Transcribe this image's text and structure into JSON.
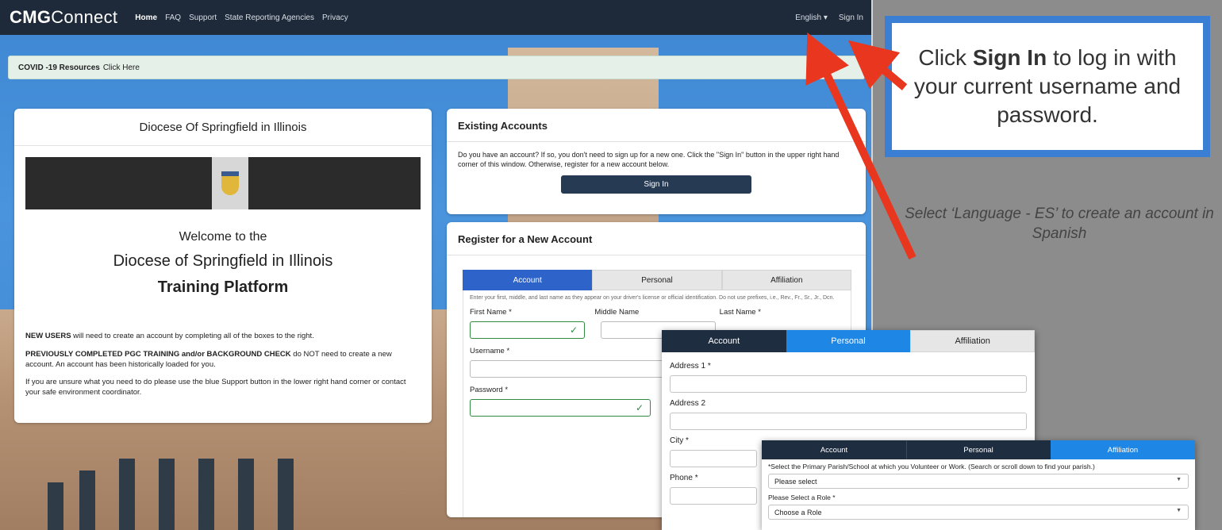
{
  "nav": {
    "brand_bold": "CMG",
    "brand_light": "Connect",
    "links": [
      "Home",
      "FAQ",
      "Support",
      "State Reporting Agencies",
      "Privacy"
    ],
    "language": "English",
    "signin": "Sign In"
  },
  "covid": {
    "bold": "COVID -19 Resources",
    "link": "Click Here"
  },
  "left": {
    "title": "Diocese Of Springfield in Illinois",
    "welcome1": "Welcome to the",
    "welcome2": "Diocese of Springfield in Illinois",
    "welcome3": "Training Platform",
    "p1_bold": "NEW USERS",
    "p1_rest": " will need to create an account by completing all of the boxes to the right.",
    "p2_bold": "PREVIOUSLY COMPLETED PGC TRAINING and/or BACKGROUND CHECK",
    "p2_rest": " do NOT need to create a new account. An account has been historically loaded for you.",
    "p3": "If you are unsure what you need to do please use the blue Support button in the lower right hand corner or contact your safe environment coordinator."
  },
  "existing": {
    "title": "Existing Accounts",
    "text": "Do you have an account? If so, you don't need to sign up for a new one. Click the \"Sign In\" button in the upper right hand corner of this window. Otherwise, register for a new account below.",
    "button": "Sign In"
  },
  "register": {
    "title": "Register for a New Account",
    "tabs": [
      "Account",
      "Personal",
      "Affiliation"
    ],
    "hint": "Enter your first, middle, and last name as they appear on your driver's license or official identification. Do not use prefixes, i.e., Rev., Fr., Sr., Jr., Dcn.",
    "first": "First Name",
    "middle": "Middle Name",
    "last": "Last Name",
    "username": "Username",
    "password": "Password",
    "req": "*"
  },
  "personal": {
    "tabs": [
      "Account",
      "Personal",
      "Affiliation"
    ],
    "address1": "Address 1",
    "address2": "Address 2",
    "city": "City",
    "phone": "Phone",
    "req": "*"
  },
  "affiliation": {
    "tabs": [
      "Account",
      "Personal",
      "Affiliation"
    ],
    "parish_label": "*Select the Primary Parish/School at which you Volunteer or Work. (Search or scroll down to find your parish.)",
    "parish_value": "Please select",
    "role_label": "Please Select a Role",
    "role_value": "Choose a Role",
    "req": "*"
  },
  "callout": {
    "pre": "Click ",
    "bold": "Sign In",
    "post": " to log in with your current username and password."
  },
  "note": "Select ‘Language - ES’ to create an account in Spanish",
  "colors": {
    "navy": "#1e2a3a",
    "tab_blue": "#2e63c9",
    "callout_border": "#3b7fd5",
    "arrow": "#e8361f",
    "valid": "#2f8a44"
  },
  "icons": {
    "dropdown": "chevron-down-icon",
    "valid": "check-icon",
    "crest": "diocese-crest-icon"
  }
}
